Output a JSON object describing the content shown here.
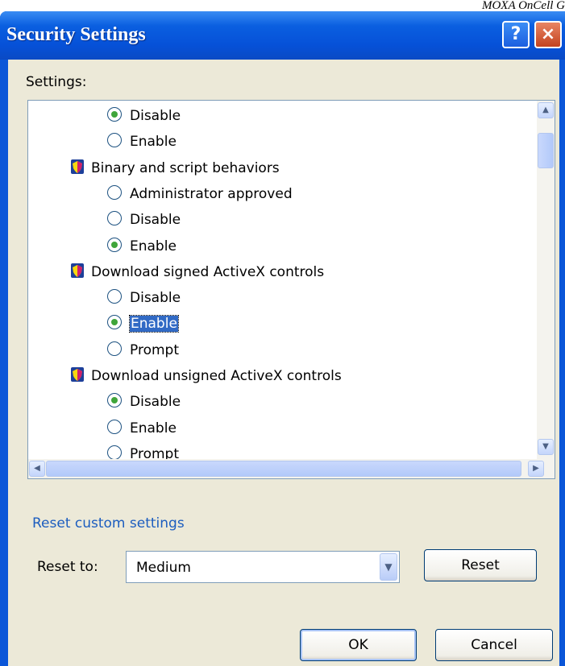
{
  "page_header": "MOXA OnCell G",
  "dialog": {
    "title": "Security Settings",
    "help_glyph": "?",
    "close_glyph": "×"
  },
  "settings": {
    "label": "Settings:",
    "rows": [
      {
        "type": "radio",
        "label": "Disable",
        "checked": true
      },
      {
        "type": "radio",
        "label": "Enable",
        "checked": false
      },
      {
        "type": "category",
        "label": "Binary and script behaviors"
      },
      {
        "type": "radio",
        "label": "Administrator approved",
        "checked": false
      },
      {
        "type": "radio",
        "label": "Disable",
        "checked": false
      },
      {
        "type": "radio",
        "label": "Enable",
        "checked": true
      },
      {
        "type": "category",
        "label": "Download signed ActiveX controls"
      },
      {
        "type": "radio",
        "label": "Disable",
        "checked": false
      },
      {
        "type": "radio",
        "label": "Enable",
        "checked": true,
        "selected": true
      },
      {
        "type": "radio",
        "label": "Prompt",
        "checked": false
      },
      {
        "type": "category",
        "label": "Download unsigned ActiveX controls"
      },
      {
        "type": "radio",
        "label": "Disable",
        "checked": true
      },
      {
        "type": "radio",
        "label": "Enable",
        "checked": false
      },
      {
        "type": "radio",
        "label": "Prompt",
        "checked": false
      }
    ]
  },
  "reset_section": {
    "title": "Reset custom settings",
    "reset_to_label": "Reset to:",
    "select_value": "Medium",
    "reset_button": "Reset"
  },
  "buttons": {
    "ok": "OK",
    "cancel": "Cancel"
  },
  "icons": {
    "category": "security-shield-icon",
    "scroll_up": "chevron-up-icon",
    "scroll_down": "chevron-down-icon",
    "scroll_left": "chevron-left-icon",
    "scroll_right": "chevron-right-icon",
    "select_arrow": "chevron-down-icon"
  },
  "colors": {
    "titlebar": "#0651d8",
    "selection": "#316ac5",
    "radio_checked": "#3fa53a",
    "link": "#1c5dbf"
  }
}
